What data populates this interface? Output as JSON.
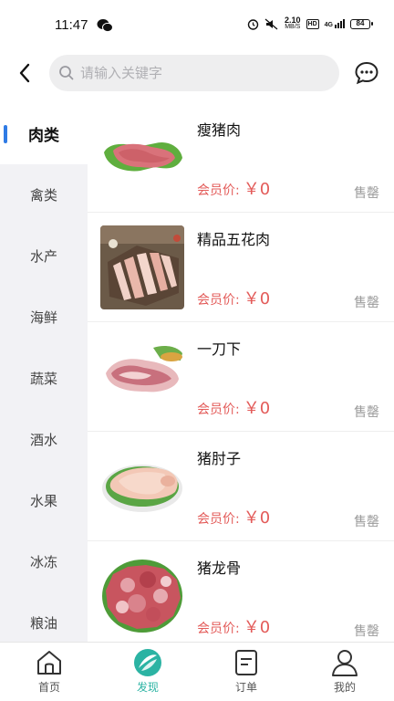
{
  "status_bar": {
    "time": "11:47",
    "net_speed_value": "2.10",
    "net_speed_unit": "MB/S",
    "hd_label": "HD",
    "signal_label": "4G",
    "battery": "84"
  },
  "header": {
    "search_placeholder": "请输入关键字"
  },
  "categories": [
    {
      "label": "肉类",
      "active": true
    },
    {
      "label": "禽类"
    },
    {
      "label": "水产"
    },
    {
      "label": "海鲜"
    },
    {
      "label": "蔬菜"
    },
    {
      "label": "酒水"
    },
    {
      "label": "水果"
    },
    {
      "label": "冰冻"
    },
    {
      "label": "粮油"
    }
  ],
  "products": [
    {
      "name": "瘦猪肉",
      "price_label": "会员价:",
      "price": "￥0",
      "status": "售罄"
    },
    {
      "name": "精品五花肉",
      "price_label": "会员价:",
      "price": "￥0",
      "status": "售罄"
    },
    {
      "name": "一刀下",
      "price_label": "会员价:",
      "price": "￥0",
      "status": "售罄"
    },
    {
      "name": "猪肘子",
      "price_label": "会员价:",
      "price": "￥0",
      "status": "售罄"
    },
    {
      "name": "猪龙骨",
      "price_label": "会员价:",
      "price": "￥0",
      "status": "售罄"
    }
  ],
  "nav": [
    {
      "label": "首页"
    },
    {
      "label": "发现",
      "active": true
    },
    {
      "label": "订单"
    },
    {
      "label": "我的"
    }
  ],
  "colors": {
    "accent_blue": "#2f7be5",
    "price_red": "#e35b59",
    "nav_active": "#2bb3a3"
  }
}
